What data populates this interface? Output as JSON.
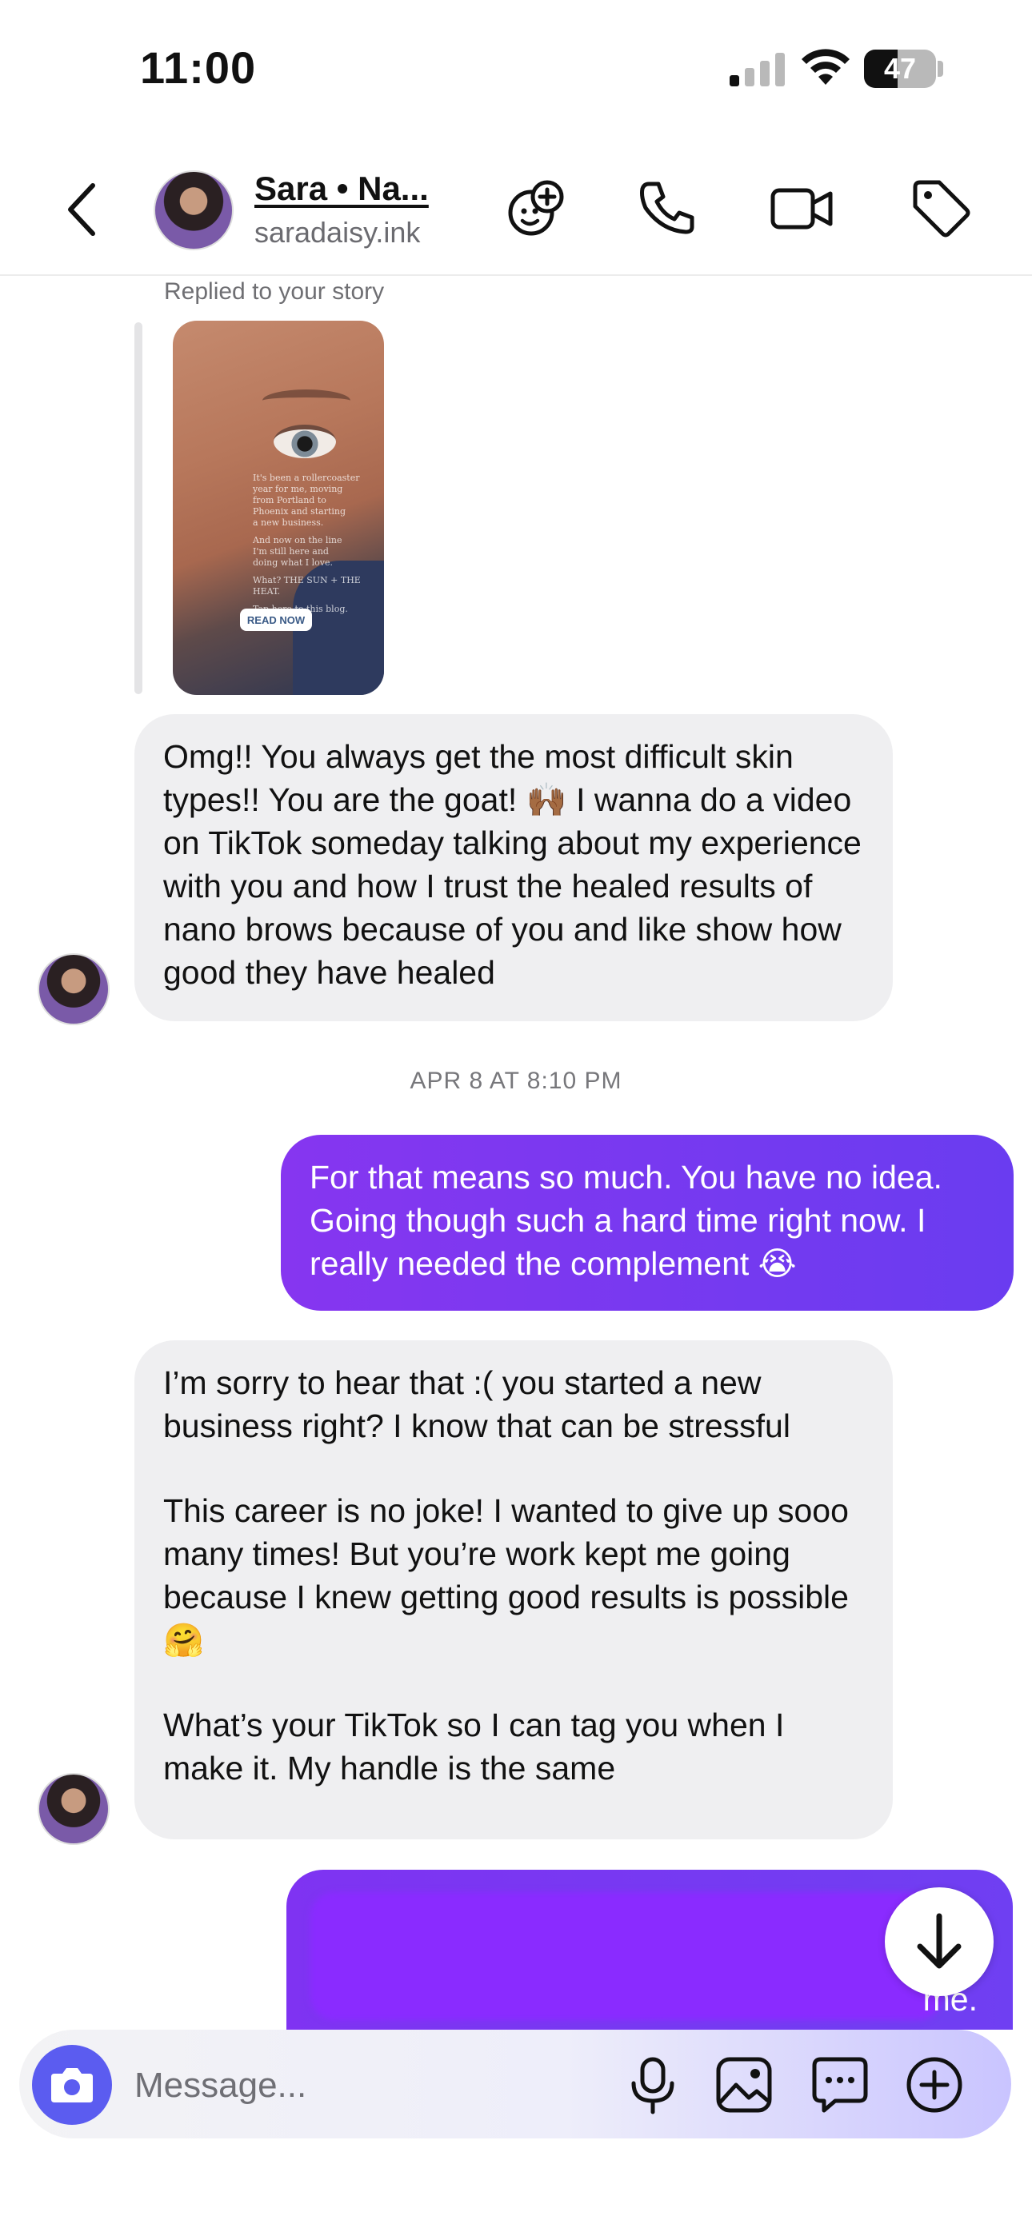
{
  "status_bar": {
    "time": "11:00",
    "battery": "47",
    "battery_level": 0.47
  },
  "header": {
    "contact_name": "Sara • Na...",
    "contact_handle": "saradaisy.ink",
    "icons": [
      "back-chevron-icon",
      "sticker-face-icon",
      "phone-icon",
      "video-camera-icon",
      "tag-icon"
    ]
  },
  "chat": {
    "story_reply_caption": "Replied to your story",
    "story_preview": {
      "text_lines": [
        "It's been a rollercoaster",
        "year for me, moving",
        "from Portland to",
        "Phoenix and starting",
        "a new business.",
        "",
        "And now on the line",
        "I'm still here and",
        "doing what I love.",
        "",
        "What? THE SUN + THE HEAT.",
        "",
        "Tap here to this blog. Read it!"
      ],
      "read_now": "READ NOW"
    },
    "messages": [
      {
        "direction": "incoming",
        "text": "Omg!! You always get the most difficult skin types!! You are the goat! 🙌🏾 I wanna do a video on TikTok someday talking about my experience with you and how I trust the healed results of nano brows because of you and like show how good they have healed"
      },
      {
        "type": "timestamp",
        "text": "APR 8 AT 8:10 PM"
      },
      {
        "direction": "outgoing",
        "text": "For that means so much. You have no idea. Going though such a hard time right now. I really needed the complement 😭"
      },
      {
        "direction": "incoming",
        "paragraphs": [
          "I’m sorry to hear that :( you started a new business right? I know that can be stressful",
          "This career is no joke! I wanted to give up sooo many times! But you’re work kept me going because I knew getting good results is possible 🤗",
          "What’s your TikTok so I can tag you when I make it. My handle is the same"
        ]
      },
      {
        "direction": "outgoing",
        "text": "me."
      }
    ]
  },
  "composer": {
    "placeholder": "Message...",
    "icons": [
      "camera-icon",
      "microphone-icon",
      "gallery-icon",
      "sticker-chat-icon",
      "add-icon"
    ]
  },
  "colors": {
    "outgoing_bubble": "#7b3af0",
    "incoming_bubble": "#efeff1",
    "camera_button": "#5b5cf0"
  }
}
